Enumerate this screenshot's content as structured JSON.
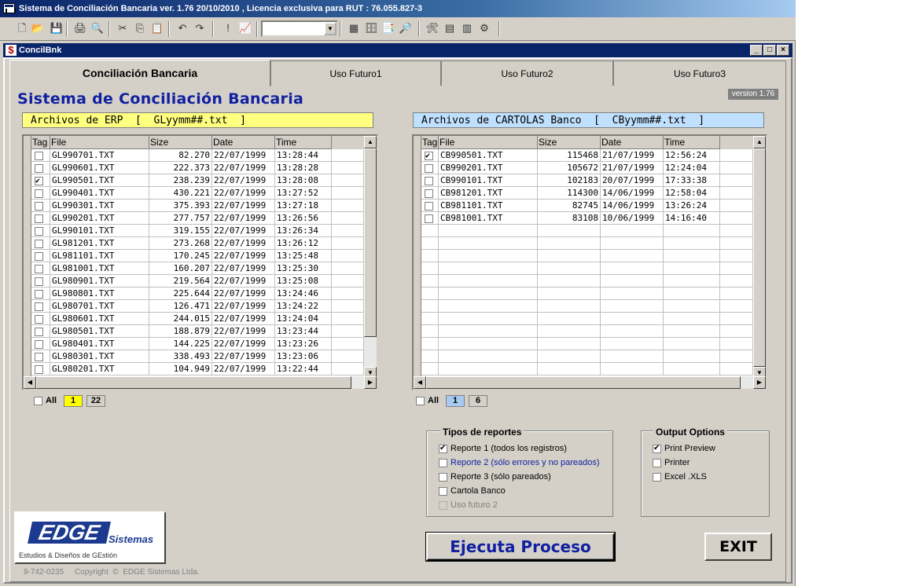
{
  "app": {
    "title": "Sistema de Conciliación Bancaria  ver. 1.76  20/10/2010 , Licencia exclusiva para RUT : 76.055.827-3"
  },
  "toolbar": {
    "icons": [
      "new-icon",
      "open-icon",
      "save-icon",
      "print-icon",
      "print-preview-icon",
      "cut-icon",
      "copy-icon",
      "paste-icon",
      "undo-icon",
      "redo-icon",
      "exclamation-icon",
      "chart-icon",
      "grid-icon",
      "database-icon",
      "properties-icon",
      "find-icon",
      "tools-icon",
      "form-icon",
      "report-icon",
      "settings-icon"
    ],
    "combo_value": ""
  },
  "child": {
    "title": "ConcilBnk",
    "minimize": "_",
    "maximize": "□",
    "close": "×"
  },
  "tabs": [
    {
      "label": "Conciliación Bancaria",
      "active": true
    },
    {
      "label": "Uso Futuro1",
      "active": false
    },
    {
      "label": "Uso Futuro2",
      "active": false
    },
    {
      "label": "Uso Futuro3",
      "active": false
    }
  ],
  "main": {
    "title": "Sistema de Conciliación Bancaria",
    "version": "version 1.76"
  },
  "erp": {
    "label": "Archivos de ERP  [  GLyymm##.txt  ]",
    "columns": [
      "Tag",
      "File",
      "Size",
      "Date",
      "Time"
    ],
    "rows": [
      {
        "tag": false,
        "file": "GL990701.TXT",
        "size": "82.270",
        "date": "22/07/1999",
        "time": "13:28:44"
      },
      {
        "tag": false,
        "file": "GL990601.TXT",
        "size": "222.373",
        "date": "22/07/1999",
        "time": "13:28:28"
      },
      {
        "tag": true,
        "file": "GL990501.TXT",
        "size": "238.239",
        "date": "22/07/1999",
        "time": "13:28:08"
      },
      {
        "tag": false,
        "file": "GL990401.TXT",
        "size": "430.221",
        "date": "22/07/1999",
        "time": "13:27:52"
      },
      {
        "tag": false,
        "file": "GL990301.TXT",
        "size": "375.393",
        "date": "22/07/1999",
        "time": "13:27:18"
      },
      {
        "tag": false,
        "file": "GL990201.TXT",
        "size": "277.757",
        "date": "22/07/1999",
        "time": "13:26:56"
      },
      {
        "tag": false,
        "file": "GL990101.TXT",
        "size": "319.155",
        "date": "22/07/1999",
        "time": "13:26:34"
      },
      {
        "tag": false,
        "file": "GL981201.TXT",
        "size": "273.268",
        "date": "22/07/1999",
        "time": "13:26:12"
      },
      {
        "tag": false,
        "file": "GL981101.TXT",
        "size": "170.245",
        "date": "22/07/1999",
        "time": "13:25:48"
      },
      {
        "tag": false,
        "file": "GL981001.TXT",
        "size": "160.207",
        "date": "22/07/1999",
        "time": "13:25:30"
      },
      {
        "tag": false,
        "file": "GL980901.TXT",
        "size": "219.564",
        "date": "22/07/1999",
        "time": "13:25:08"
      },
      {
        "tag": false,
        "file": "GL980801.TXT",
        "size": "225.644",
        "date": "22/07/1999",
        "time": "13:24:46"
      },
      {
        "tag": false,
        "file": "GL980701.TXT",
        "size": "126.471",
        "date": "22/07/1999",
        "time": "13:24:22"
      },
      {
        "tag": false,
        "file": "GL980601.TXT",
        "size": "244.015",
        "date": "22/07/1999",
        "time": "13:24:04"
      },
      {
        "tag": false,
        "file": "GL980501.TXT",
        "size": "188.879",
        "date": "22/07/1999",
        "time": "13:23:44"
      },
      {
        "tag": false,
        "file": "GL980401.TXT",
        "size": "144.225",
        "date": "22/07/1999",
        "time": "13:23:26"
      },
      {
        "tag": false,
        "file": "GL980301.TXT",
        "size": "338.493",
        "date": "22/07/1999",
        "time": "13:23:06"
      },
      {
        "tag": false,
        "file": "GL980201.TXT",
        "size": "104.949",
        "date": "22/07/1999",
        "time": "13:22:44"
      }
    ],
    "all_label": "All",
    "selected_count": "1",
    "total_count": "22"
  },
  "banco": {
    "label": "Archivos de CARTOLAS Banco  [  CByymm##.txt  ]",
    "columns": [
      "Tag",
      "File",
      "Size",
      "Date",
      "Time"
    ],
    "rows": [
      {
        "tag": true,
        "file": "CB990501.TXT",
        "size": "115468",
        "date": "21/07/1999",
        "time": "12:56:24"
      },
      {
        "tag": false,
        "file": "CB990201.TXT",
        "size": "105672",
        "date": "21/07/1999",
        "time": "12:24:04"
      },
      {
        "tag": false,
        "file": "CB990101.TXT",
        "size": "102183",
        "date": "20/07/1999",
        "time": "17:33:38"
      },
      {
        "tag": false,
        "file": "CB981201.TXT",
        "size": "114300",
        "date": "14/06/1999",
        "time": "12:58:04"
      },
      {
        "tag": false,
        "file": "CB981101.TXT",
        "size": "82745",
        "date": "14/06/1999",
        "time": "13:26:24"
      },
      {
        "tag": false,
        "file": "CB981001.TXT",
        "size": "83108",
        "date": "10/06/1999",
        "time": "14:16:40"
      }
    ],
    "all_label": "All",
    "selected_count": "1",
    "total_count": "6"
  },
  "reportes": {
    "title": "Tipos de reportes",
    "options": [
      {
        "label": "Reporte 1 (todos los registros)",
        "checked": true,
        "disabled": false,
        "color": "#000000"
      },
      {
        "label": "Reporte 2 (sólo errores y no pareados)",
        "checked": false,
        "disabled": false,
        "color": "#1020a0"
      },
      {
        "label": "Reporte 3 (sólo pareados)",
        "checked": false,
        "disabled": false,
        "color": "#000000"
      },
      {
        "label": "Cartola Banco",
        "checked": false,
        "disabled": false,
        "color": "#000000"
      },
      {
        "label": "Uso futuro 2",
        "checked": false,
        "disabled": true,
        "color": "#808080"
      }
    ]
  },
  "output": {
    "title": "Output Options",
    "options": [
      {
        "label": "Print Preview",
        "checked": true
      },
      {
        "label": "Printer",
        "checked": false
      },
      {
        "label": "Excel  .XLS",
        "checked": false
      }
    ]
  },
  "logo": {
    "word": "EDGE",
    "sistemas": "Sistemas",
    "subtitle": "Estudios & Diseños de GEstión"
  },
  "footer": {
    "copyright": "9-742-0235     Copyright  ©  EDGE Sistemas Ltda."
  },
  "actions": {
    "run_label": "Ejecuta Proceso",
    "exit_label": "EXIT"
  },
  "colors": {
    "erp_box": "#ffff80",
    "banco_box": "#c0e0ff",
    "title_blue": "#1020a0",
    "face": "#d4d0c8"
  }
}
